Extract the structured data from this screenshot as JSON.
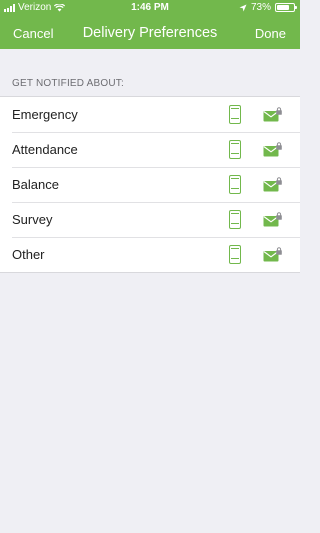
{
  "status_bar": {
    "carrier": "Verizon",
    "time": "1:46 PM",
    "battery_percent": "73%",
    "battery_level": 0.73
  },
  "nav": {
    "cancel_label": "Cancel",
    "title": "Delivery Preferences",
    "done_label": "Done"
  },
  "section": {
    "header": "GET NOTIFIED ABOUT:"
  },
  "items": [
    {
      "label": "Emergency"
    },
    {
      "label": "Attendance"
    },
    {
      "label": "Balance"
    },
    {
      "label": "Survey"
    },
    {
      "label": "Other"
    }
  ],
  "icons": {
    "sms": "phone-icon",
    "email": "envelope-lock-icon"
  },
  "colors": {
    "accent": "#72b84c",
    "background": "#efeff4",
    "lock": "#8e8e93"
  }
}
